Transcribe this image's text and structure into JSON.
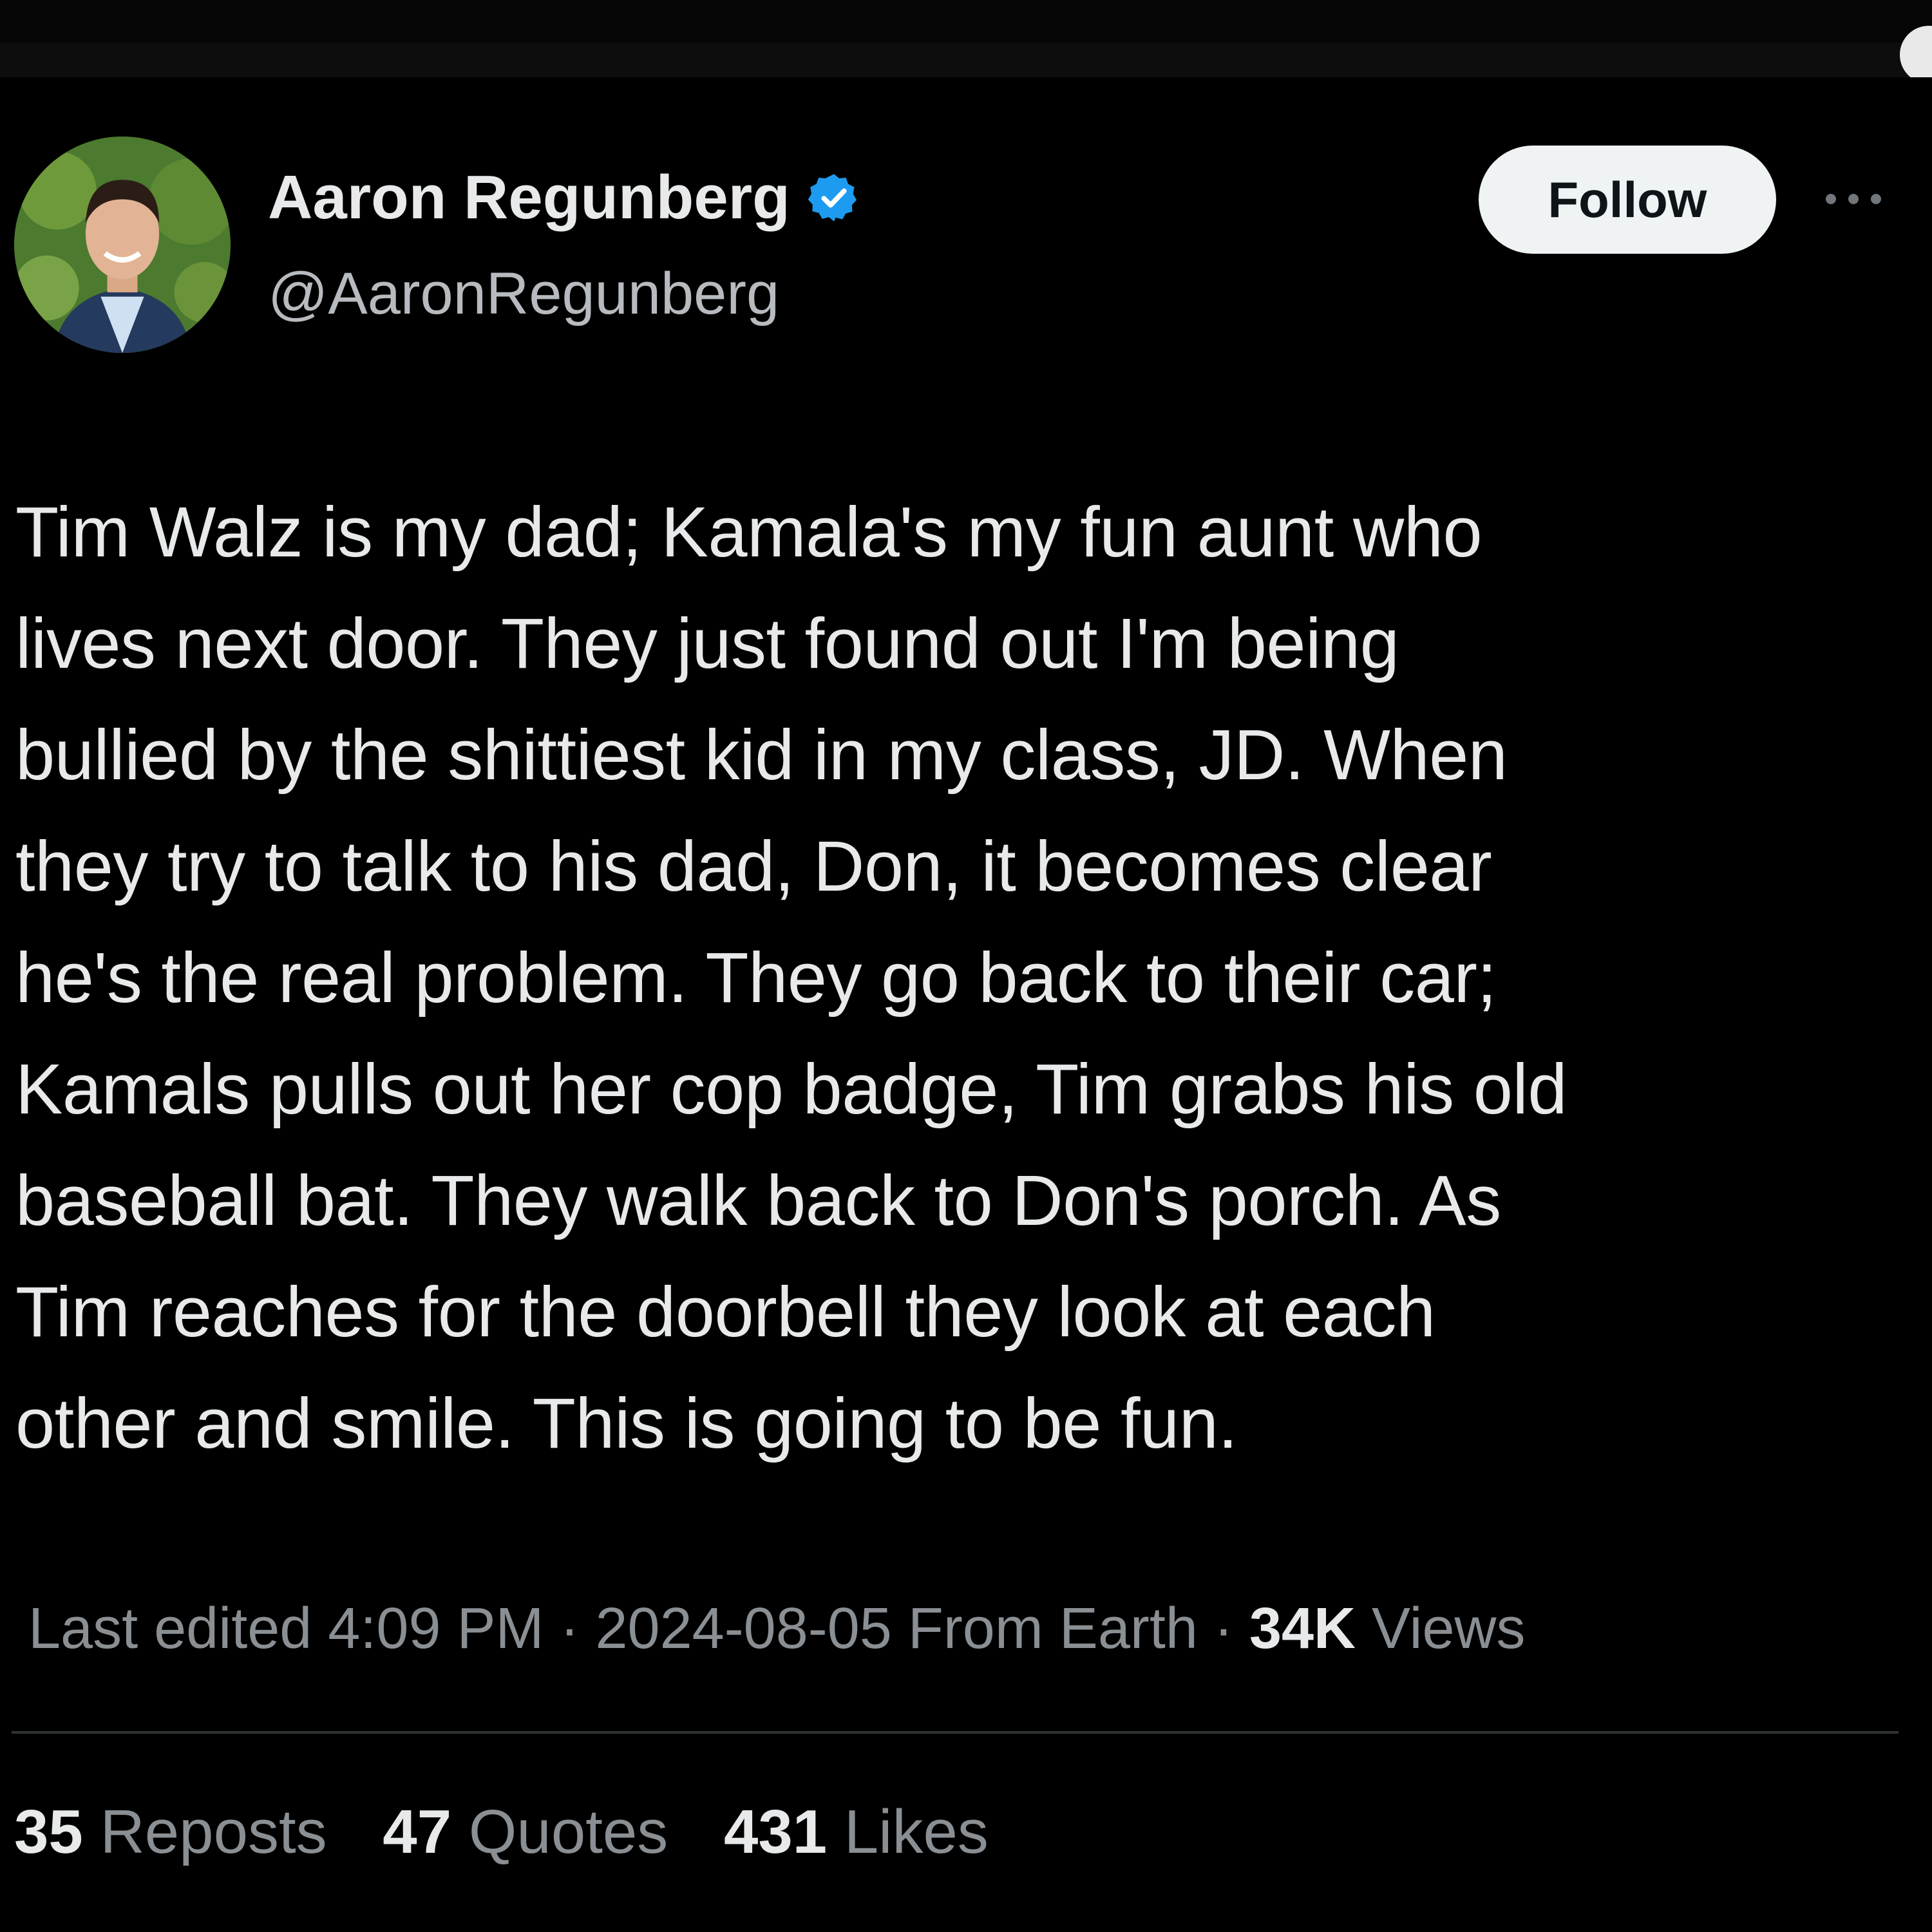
{
  "author": {
    "display_name": "Aaron Regunberg",
    "handle": "@AaronRegunberg",
    "verified": true,
    "verified_color": "#1d9bf0"
  },
  "actions": {
    "follow_label": "Follow",
    "more_icon": "more-horizontal-icon"
  },
  "tweet": {
    "text": "Tim Walz is my dad; Kamala's my fun aunt who\nlives next door. They just found out I'm being\nbullied by the shittiest kid in my class, JD. When\nthey try to talk to his dad, Don, it becomes clear\nhe's the real problem. They go back to their car;\nKamals pulls out her cop badge, Tim grabs his old\nbaseball bat. They walk back to Don's porch. As\nTim reaches for the doorbell they look at each\nother and smile. This is going to be fun."
  },
  "meta": {
    "prefix": "Last edited 4:09 PM · 2024-08-05  From Earth · ",
    "views_count": "34K",
    "views_label": " Views"
  },
  "stats": {
    "reposts_count": "35",
    "reposts_label": " Reposts",
    "quotes_count": "47",
    "quotes_label": " Quotes",
    "likes_count": "431",
    "likes_label": " Likes"
  },
  "colors": {
    "background": "#000000",
    "text_primary": "#e7e9ea",
    "text_secondary": "#8a8f94",
    "follow_bg": "#eff3f4"
  }
}
